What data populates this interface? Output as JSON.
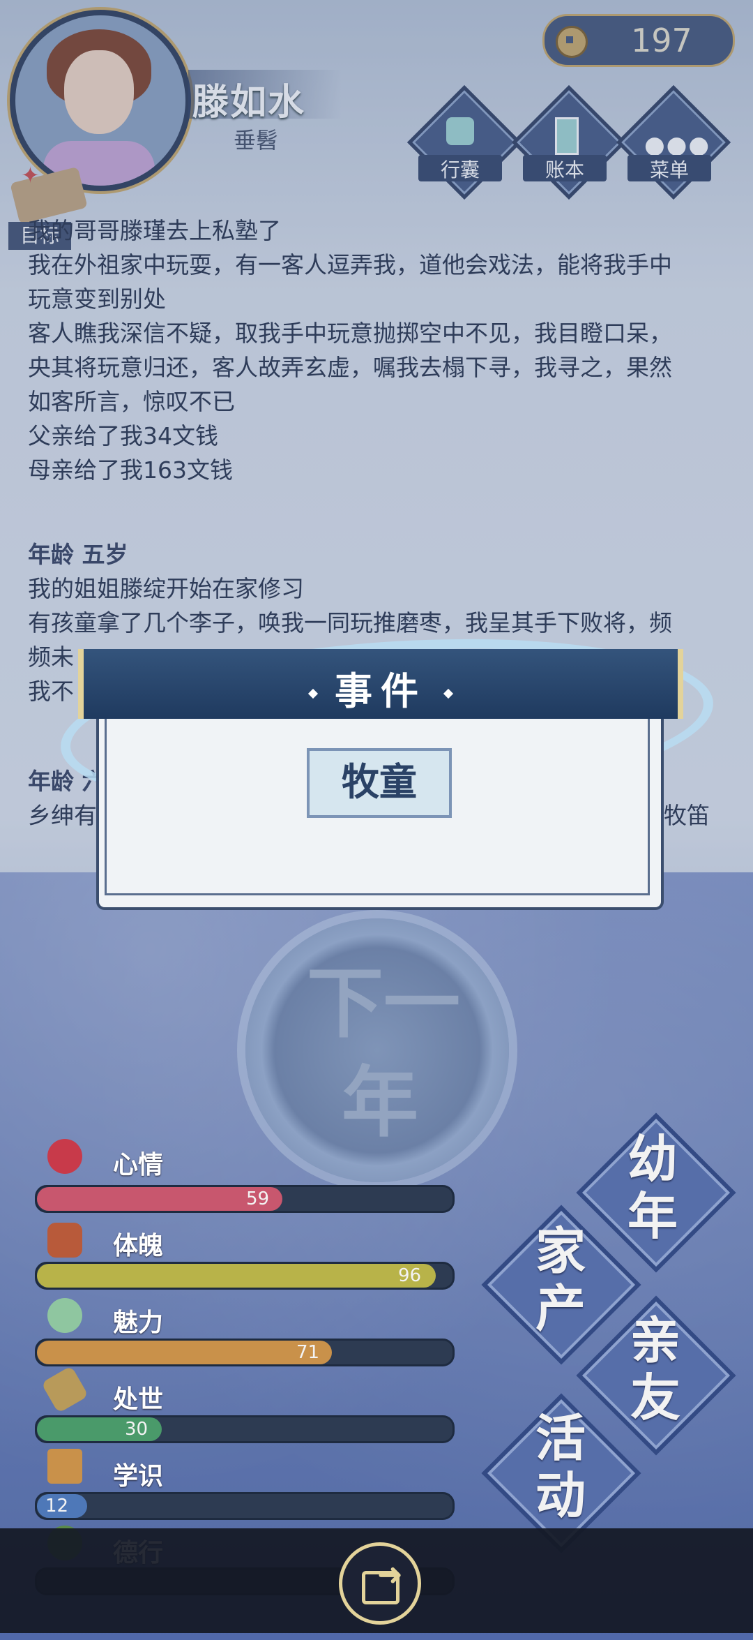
{
  "header": {
    "name": "滕如水",
    "stage": "垂髫",
    "coins": "197",
    "buttons": [
      {
        "label": "行囊",
        "icon": "bag-icon"
      },
      {
        "label": "账本",
        "icon": "ledger-icon"
      },
      {
        "label": "菜单",
        "icon": "menu-icon"
      }
    ],
    "target_tag": "目标"
  },
  "story": {
    "lines": [
      "我的哥哥滕瑾去上私塾了",
      "我在外祖家中玩耍，有一客人逗弄我，道他会戏法，能将我手中",
      "玩意变到别处",
      "客人瞧我深信不疑，取我手中玩意抛掷空中不见，我目瞪口呆，",
      "央其将玩意归还，客人故弄玄虚，嘱我去榻下寻，我寻之，果然",
      "如客所言，惊叹不已",
      "父亲给了我34文钱",
      "母亲给了我163文钱"
    ],
    "age5": "年龄 五岁",
    "age5_lines": [
      "我的姐姐滕绽开始在家修习",
      "有孩童拿了几个李子，唤我一同玩推磨枣，我呈其手下败将，频",
      "频未",
      "我不"
    ],
    "age6": "年龄 六",
    "age6_line_start": "乡绅有",
    "age6_line_end": "牧笛"
  },
  "event_modal": {
    "title": "事件",
    "event_name": "牧童"
  },
  "next_year": {
    "line1": "下一",
    "line2": "年"
  },
  "stats": [
    {
      "label": "心情",
      "value": 59,
      "max": 100,
      "color": "#c8576e",
      "icon": "flower-icon"
    },
    {
      "label": "体魄",
      "value": 96,
      "max": 100,
      "color": "#b8b349",
      "icon": "gourd-icon"
    },
    {
      "label": "魅力",
      "value": 71,
      "max": 100,
      "color": "#c9914a",
      "icon": "jade-icon"
    },
    {
      "label": "处世",
      "value": 30,
      "max": 100,
      "color": "#4a9a6a",
      "icon": "bow-icon"
    },
    {
      "label": "学识",
      "value": 12,
      "max": 100,
      "color": "#4e78b8",
      "icon": "brush-icon"
    },
    {
      "label": "德行",
      "value": 0,
      "max": 100,
      "color": "#6a4e9a",
      "icon": "mirror-icon"
    }
  ],
  "menu": {
    "childhood": "幼年",
    "family_assets": "家产",
    "relatives": "亲友",
    "activities": "活动"
  }
}
